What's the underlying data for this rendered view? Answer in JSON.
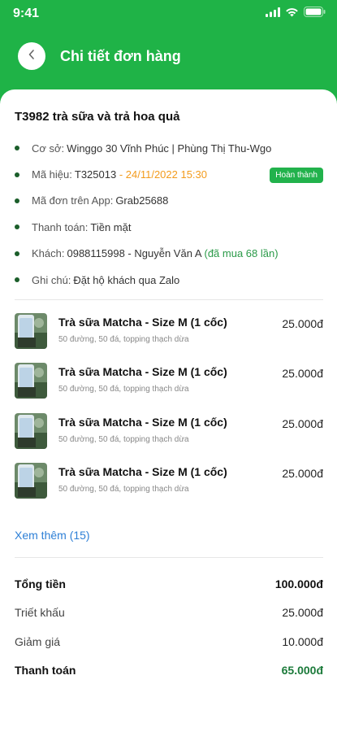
{
  "status_bar": {
    "time": "9:41"
  },
  "header": {
    "title": "Chi tiết đơn hàng"
  },
  "order": {
    "title": "T3982 trà sữa và trả hoa quả",
    "info": {
      "store_label": "Cơ sở:",
      "store_value": "Winggo 30 Vĩnh Phúc | Phùng Thị Thu-Wgo",
      "code_label": "Mã hiệu:",
      "code_value": "T325013",
      "code_sep": " - ",
      "code_datetime": "24/11/2022 15:30",
      "status_badge": "Hoàn thành",
      "app_label": "Mã đơn trên App:",
      "app_value": "Grab25688",
      "payment_label": "Thanh toán:",
      "payment_value": "Tiền mặt",
      "customer_label": "Khách:",
      "customer_value": "0988115998 - Nguyễn Văn A",
      "customer_history": "(đã mua 68 lần)",
      "note_label": "Ghi chú:",
      "note_value": "Đặt hộ khách qua Zalo"
    }
  },
  "items": [
    {
      "name": "Trà sữa Matcha - Size M (1 cốc)",
      "desc": "50 đường, 50 đá, topping thạch dừa",
      "price": "25.000đ"
    },
    {
      "name": "Trà sữa Matcha - Size M (1 cốc)",
      "desc": "50 đường, 50 đá, topping thạch dừa",
      "price": "25.000đ"
    },
    {
      "name": "Trà sữa Matcha - Size M (1 cốc)",
      "desc": "50 đường, 50 đá, topping thạch dừa",
      "price": "25.000đ"
    },
    {
      "name": "Trà sữa Matcha - Size M (1 cốc)",
      "desc": "50 đường, 50 đá, topping thạch dừa",
      "price": "25.000đ"
    }
  ],
  "see_more": "Xem thêm (15)",
  "totals": {
    "subtotal_label": "Tổng tiền",
    "subtotal_value": "100.000đ",
    "discount_label": "Triết khấu",
    "discount_value": "25.000đ",
    "promo_label": "Giảm giá",
    "promo_value": "10.000đ",
    "payment_label": "Thanh toán",
    "payment_value": "65.000đ"
  },
  "colors": {
    "brand_green": "#1fb347",
    "badge_green": "#22b24c",
    "date_orange": "#f39b1c",
    "link_blue": "#2d7fd6"
  },
  "icons": [
    "signal-icon",
    "wifi-icon",
    "battery-icon",
    "back-chevron-icon",
    "product-thumbnail"
  ]
}
